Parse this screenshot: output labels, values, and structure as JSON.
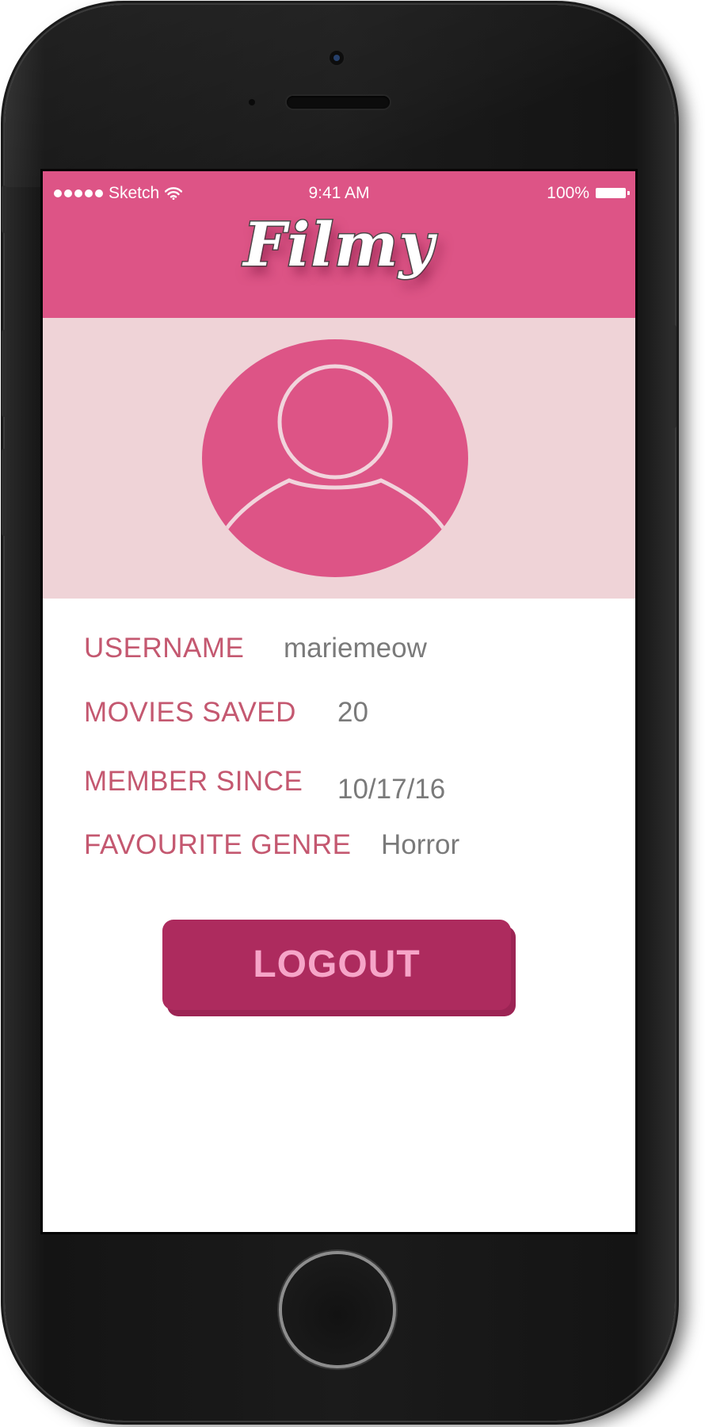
{
  "status_bar": {
    "carrier": "Sketch",
    "time": "9:41 AM",
    "battery": "100%",
    "signal_icon": "signal-dots-icon",
    "wifi_icon": "wifi-icon",
    "battery_icon": "battery-icon"
  },
  "app": {
    "title": "Filmy"
  },
  "avatar": {
    "icon": "user-avatar-icon"
  },
  "profile": {
    "rows": [
      {
        "label": "USERNAME",
        "value": "mariemeow"
      },
      {
        "label": "MOVIES SAVED",
        "value": "20"
      },
      {
        "label": "MEMBER SINCE",
        "value": "10/17/16"
      },
      {
        "label": "FAVOURITE GENRE",
        "value": "Horror"
      }
    ]
  },
  "actions": {
    "logout_label": "LOGOUT"
  },
  "colors": {
    "brand_pink": "#dd5486",
    "avatar_bg": "#efd3d7",
    "label": "#c45870",
    "value": "#7a7a7a",
    "button": "#ad2b5e",
    "button_text": "#f6a5c8"
  }
}
